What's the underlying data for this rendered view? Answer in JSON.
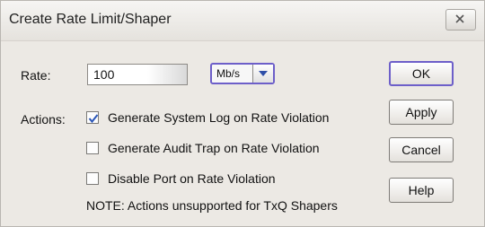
{
  "window": {
    "title": "Create Rate Limit/Shaper",
    "close_icon": "close-icon"
  },
  "form": {
    "rate_label": "Rate:",
    "rate_value": "100",
    "unit_selected": "Mb/s",
    "actions_label": "Actions:",
    "actions": [
      {
        "label": "Generate System Log on Rate Violation",
        "checked": true
      },
      {
        "label": "Generate Audit Trap on Rate Violation",
        "checked": false
      },
      {
        "label": "Disable Port on Rate Violation",
        "checked": false
      }
    ],
    "note": "NOTE: Actions unsupported for TxQ Shapers"
  },
  "buttons": {
    "ok": "OK",
    "apply": "Apply",
    "cancel": "Cancel",
    "help": "Help"
  },
  "colors": {
    "focus_border": "#6d5fc9",
    "check_mark": "#2a56b8",
    "dialog_bg": "#ece9e4"
  }
}
